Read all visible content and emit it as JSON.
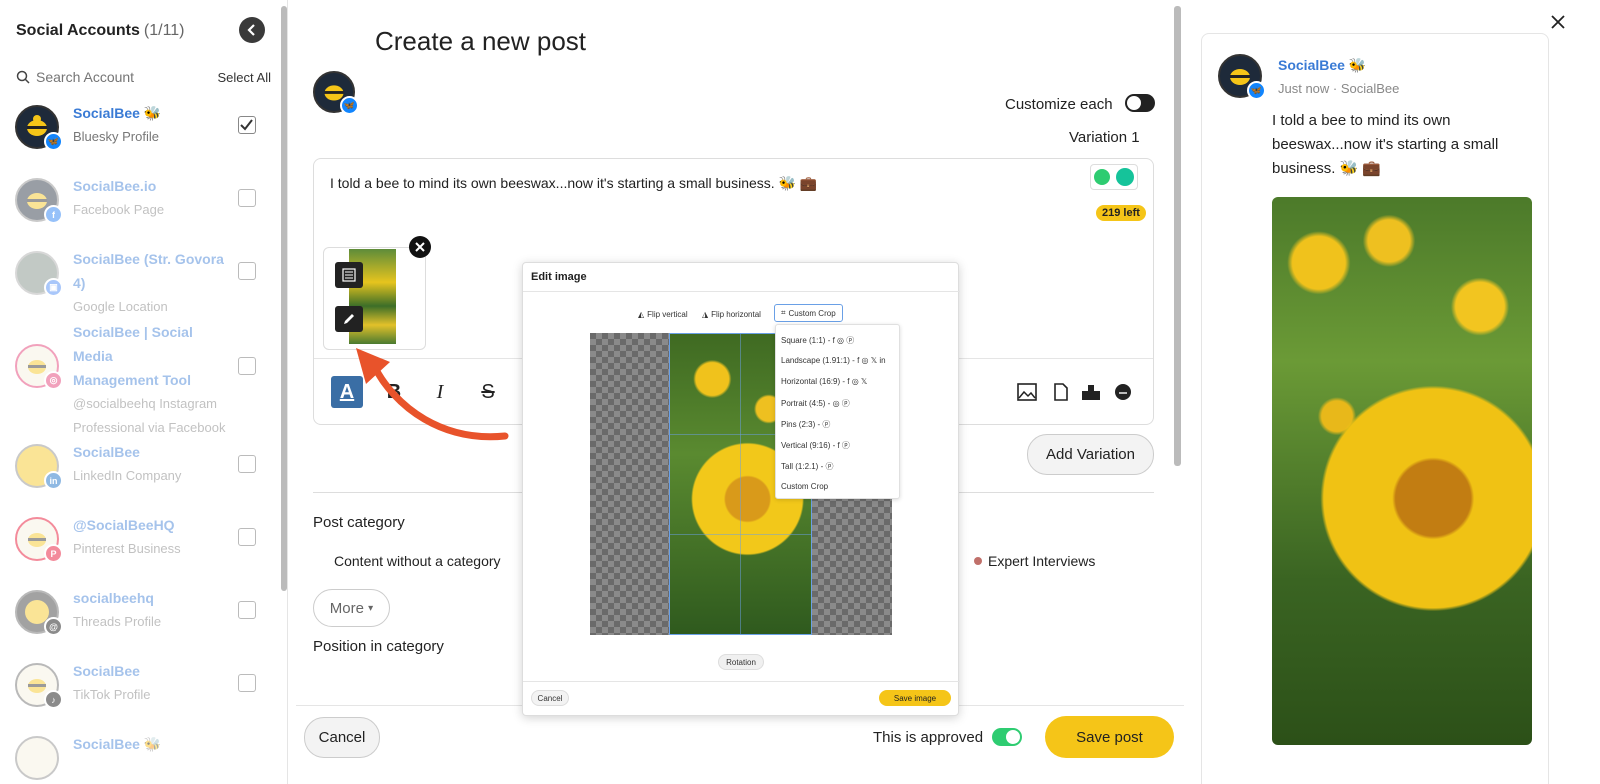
{
  "sidebar": {
    "title": "Social Accounts",
    "count": "(1/11)",
    "search_placeholder": "Search Account",
    "select_all": "Select All",
    "accounts": [
      {
        "name": "SocialBee 🐝",
        "type": "Bluesky Profile",
        "checked": true
      },
      {
        "name": "SocialBee.io",
        "type": "Facebook Page",
        "checked": false
      },
      {
        "name": "SocialBee (Str. Govora 4)",
        "type": "Google Location",
        "checked": false
      },
      {
        "name_line1": "SocialBee | Social Media",
        "name_line2": "Management Tool",
        "type_line1": "@socialbeehq Instagram",
        "type_line2": "Professional via Facebook",
        "checked": false
      },
      {
        "name": "SocialBee",
        "type": "LinkedIn Company",
        "checked": false
      },
      {
        "name": "@SocialBeeHQ",
        "type": "Pinterest Business",
        "checked": false
      },
      {
        "name": "socialbeehq",
        "type": "Threads Profile",
        "checked": false
      },
      {
        "name": "SocialBee",
        "type": "TikTok Profile",
        "checked": false
      },
      {
        "name": "SocialBee 🐝",
        "type": "",
        "checked": false
      }
    ]
  },
  "main": {
    "title": "Create a new post",
    "customize_label": "Customize each",
    "variation_label": "Variation 1",
    "post_text": "I told a bee to mind its own beeswax...now it's starting a small business. 🐝 💼",
    "chars_left": "219 left",
    "add_variation": "Add Variation",
    "post_category_label": "Post category",
    "category_none": "Content without a category",
    "category_expert": "Expert Interviews",
    "more_label": "More",
    "position_label": "Position in category",
    "cancel_label": "Cancel",
    "approved_label": "This is approved",
    "save_label": "Save post"
  },
  "modal": {
    "title": "Edit image",
    "flip_vertical": "Flip vertical",
    "flip_horizontal": "Flip horizontal",
    "custom_crop": "Custom Crop",
    "crop_options": [
      "Square (1:1) -",
      "Landscape (1.91:1) -",
      "Horizontal (16:9) -",
      "Portrait (4:5) -",
      "Pins (2:3) -",
      "Vertical (9:16) -",
      "Tall (1:2.1) -",
      "Custom Crop"
    ],
    "rotation": "Rotation",
    "cancel": "Cancel",
    "save": "Save image"
  },
  "preview": {
    "name": "SocialBee 🐝",
    "meta": "Just now · SocialBee",
    "text": "I told a bee to mind its own beeswax...now it's starting a small business. 🐝 💼"
  },
  "colors": {
    "accent_yellow": "#f5c518",
    "link_blue": "#3a7bd5",
    "toggle_green": "#2ecc71",
    "arrow_orange": "#e8532b",
    "bluesky": "#1185fe",
    "facebook": "#1877f2",
    "instagram": "#e1306c",
    "linkedin": "#0a66c2",
    "pinterest": "#e60023"
  }
}
